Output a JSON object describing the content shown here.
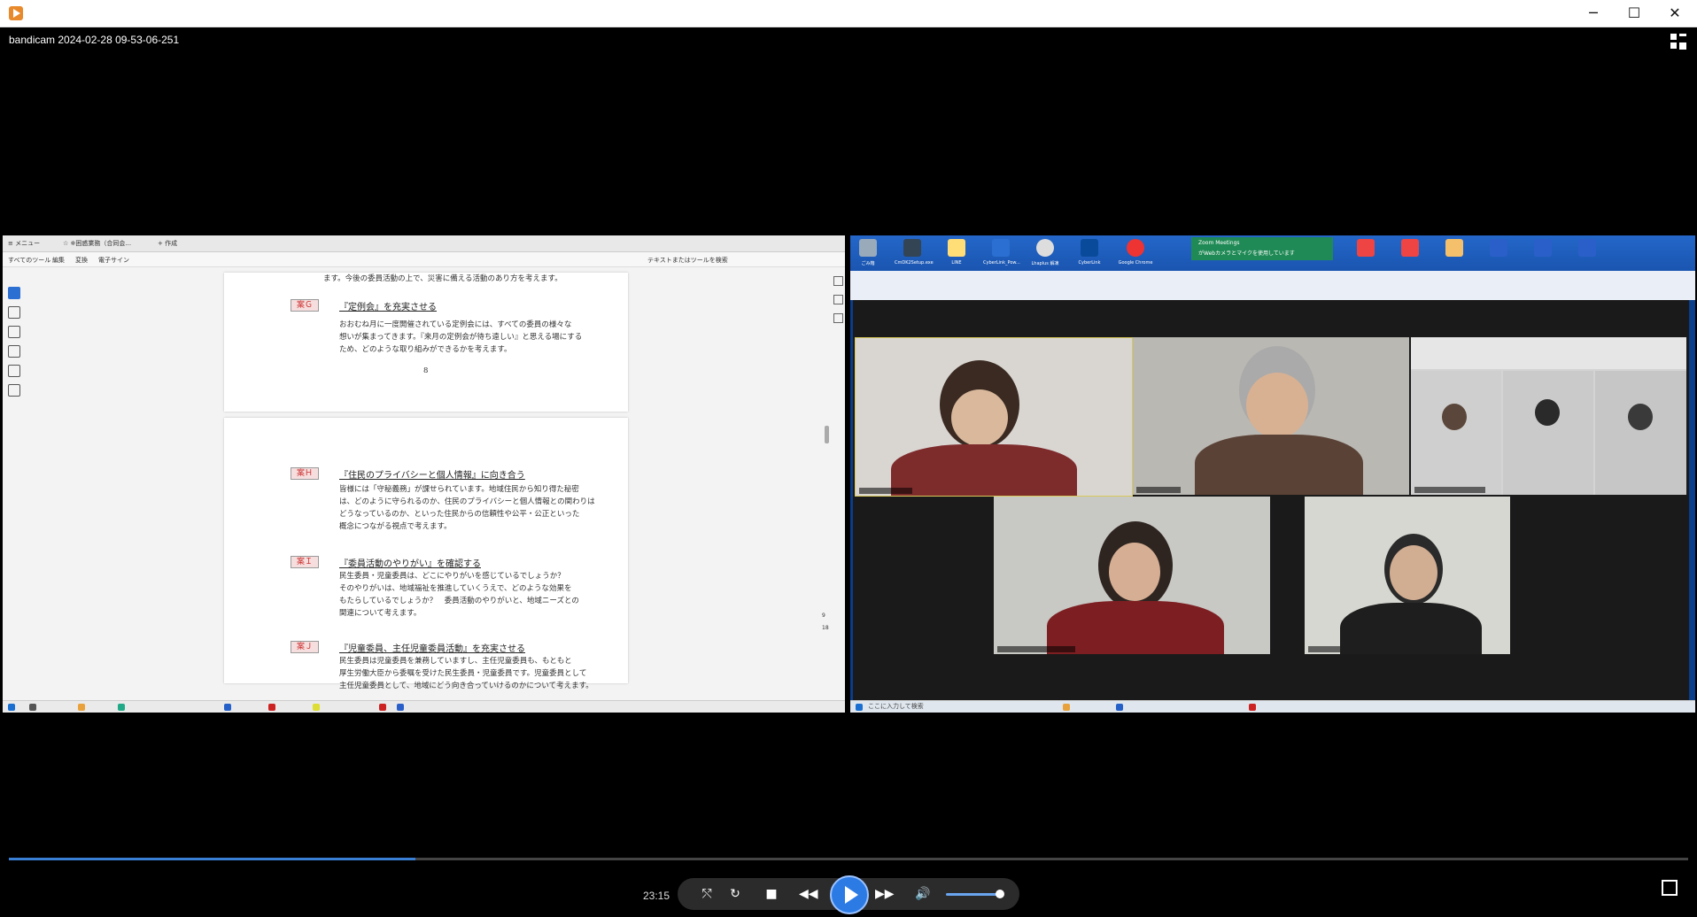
{
  "window": {
    "video_title": "bandicam 2024-02-28 09-53-06-251",
    "minimize": "─",
    "maximize": "☐",
    "close": "✕"
  },
  "pdf": {
    "menu": "≡ メニュー",
    "tab_title": "☆ ※困惑業務（合同会...",
    "new_tab": "+ 作成",
    "toolbar": [
      "すべてのツール",
      "編集",
      "変換",
      "電子サイン"
    ],
    "search": "テキストまたはツールを検索",
    "page1_top": "ます。今後の委員活動の上で、災害に備える活動のあり方を考えます。",
    "caseG_tag": "案Ｇ",
    "caseG_title": "『定例会』を充実させる",
    "caseG_body": [
      "おおむね月に一度開催されている定例会には、すべての委員の様々な",
      "想いが集まってきます。『来月の定例会が待ち遠しい』と思える場にする",
      "ため、どのような取り組みができるかを考えます。"
    ],
    "page_number": "8",
    "caseH_tag": "案Ｈ",
    "caseH_title": "『住民のプライバシーと個人情報』に向き合う",
    "caseH_body": [
      "皆様には「守秘義務」が課せられています。地域住民から知り得た秘密",
      "は、どのように守られるのか、住民のプライバシーと個人情報との関わりは",
      "どうなっているのか、といった住民からの信頼性や公平・公正といった",
      "概念につながる視点で考えます。"
    ],
    "caseI_tag": "案Ｉ",
    "caseI_title": "『委員活動のやりがい』を確認する",
    "caseI_body": [
      "民生委員・児童委員は、どこにやりがいを感じているでしょうか？",
      "そのやりがいは、地域福祉を推進していくうえで、どのような効果を",
      "もたらしているでしょうか？　委員活動のやりがいと、地域ニーズとの",
      "関連について考えます。"
    ],
    "caseJ_tag": "案Ｊ",
    "caseJ_title": "『児童委員、主任児童委員活動』を充実させる",
    "caseJ_body": [
      "民生委員は児童委員を兼務していますし、主任児童委員も、もともと",
      "厚生労働大臣から委嘱を受けた民生委員・児童委員です。児童委員として",
      "主任児童委員として、地域にどう向き合っていけるのかについて考えます。"
    ],
    "page_count_a": "9",
    "page_count_b": "18"
  },
  "desktop": {
    "icons": [
      "ごみ箱",
      "CmDK2Setup.exe",
      "LINE",
      "CyberLink_Pow...",
      "Lhaplus 解凍",
      "CyberLink",
      "Google Chrome"
    ],
    "notification_title": "Zoom Meetings",
    "notification_body": "がWebカメラとマイクを使用しています",
    "search_placeholder": "ここに入力して検索"
  },
  "player": {
    "time": "23:15",
    "progress": 0.242,
    "volume": 0.85
  },
  "colors": {
    "accent": "#2c7be5",
    "case_tag": "#c33"
  }
}
